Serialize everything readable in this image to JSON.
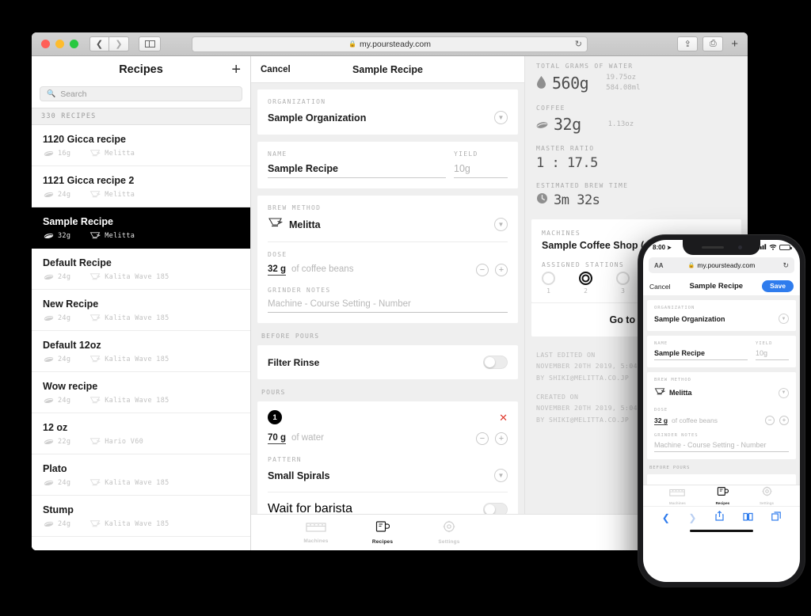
{
  "browser": {
    "url": "my.poursteady.com",
    "lock_icon": "lock-icon",
    "reload_icon": "reload-icon",
    "back_icon": "back-chevron-icon",
    "forward_icon": "forward-chevron-icon",
    "sidebar_icon": "sidebar-toggle-icon",
    "share_icon": "share-icon",
    "tabs_icon": "tabs-icon",
    "new_tab_icon": "plus-icon"
  },
  "sidebar": {
    "title": "Recipes",
    "add_icon": "plus-icon",
    "search": {
      "placeholder": "Search",
      "value": "",
      "icon": "search-icon"
    },
    "section_header": "330 RECIPES",
    "recipes": [
      {
        "name": "1120 Gicca recipe",
        "dose": "16g",
        "brew_method": "Melitta",
        "selected": false
      },
      {
        "name": "1121 Gicca recipe 2",
        "dose": "24g",
        "brew_method": "Melitta",
        "selected": false
      },
      {
        "name": "Sample Recipe",
        "dose": "32g",
        "brew_method": "Melitta",
        "selected": true
      },
      {
        "name": "Default Recipe",
        "dose": "24g",
        "brew_method": "Kalita Wave 185",
        "selected": false
      },
      {
        "name": "New Recipe",
        "dose": "24g",
        "brew_method": "Kalita Wave 185",
        "selected": false
      },
      {
        "name": "Default 12oz",
        "dose": "24g",
        "brew_method": "Kalita Wave 185",
        "selected": false
      },
      {
        "name": "Wow recipe",
        "dose": "24g",
        "brew_method": "Kalita Wave 185",
        "selected": false
      },
      {
        "name": "12 oz",
        "dose": "22g",
        "brew_method": "Hario V60",
        "selected": false
      },
      {
        "name": "Plato",
        "dose": "24g",
        "brew_method": "Kalita Wave 185",
        "selected": false
      },
      {
        "name": "Stump",
        "dose": "24g",
        "brew_method": "Kalita Wave 185",
        "selected": false
      }
    ]
  },
  "detail": {
    "cancel_label": "Cancel",
    "title": "Sample Recipe",
    "organization": {
      "label": "ORGANIZATION",
      "value": "Sample Organization"
    },
    "name": {
      "label": "NAME",
      "value": "Sample Recipe"
    },
    "yield": {
      "label": "YIELD",
      "value": "10g"
    },
    "brew_method": {
      "label": "BREW METHOD",
      "value": "Melitta"
    },
    "dose": {
      "label": "DOSE",
      "value": "32 g",
      "unit": "of coffee beans",
      "minus": "−",
      "plus": "+"
    },
    "grinder_notes": {
      "label": "GRINDER NOTES",
      "placeholder": "Machine - Course Setting - Number",
      "value": ""
    },
    "before_pours": {
      "group_label": "BEFORE POURS",
      "filter_rinse_label": "Filter Rinse",
      "filter_rinse_on": false
    },
    "pours": {
      "group_label": "POURS",
      "items": [
        {
          "number": "1",
          "amount": "70 g",
          "unit": "of water",
          "pattern_label": "PATTERN",
          "pattern_value": "Small Spirals",
          "wait_label": "Wait for barista",
          "wait_on": false,
          "delete_icon": "close-icon"
        }
      ]
    }
  },
  "stats": {
    "total_water": {
      "label": "TOTAL GRAMS OF WATER",
      "value": "560g",
      "alt1": "19.75oz",
      "alt2": "584.08ml",
      "icon": "water-drop-icon"
    },
    "coffee": {
      "label": "COFFEE",
      "value": "32g",
      "alt1": "1.13oz",
      "icon": "coffee-bean-icon"
    },
    "master_ratio": {
      "label": "MASTER RATIO",
      "value": "1 : 17.5"
    },
    "brew_time": {
      "label": "ESTIMATED BREW TIME",
      "value": "3m 32s",
      "icon": "clock-icon"
    },
    "machines": {
      "label": "MACHINES",
      "name": "Sample Coffee Shop (",
      "stations_label": "ASSIGNED STATIONS",
      "stations": [
        {
          "number": "1",
          "active": false
        },
        {
          "number": "2",
          "active": true
        },
        {
          "number": "3",
          "active": false
        }
      ],
      "goto_label": "Go to Mach"
    },
    "log": {
      "last_edited_label": "LAST EDITED ON",
      "last_edited_date": "NOVEMBER 20TH 2019, 5:04",
      "last_edited_by": "BY SHIKI@MELITTA.CO.JP",
      "created_label": "CREATED ON",
      "created_date": "NOVEMBER 20TH 2019, 5:04",
      "created_by": "BY SHIKI@MELITTA.CO.JP"
    }
  },
  "tabbar": {
    "machines": "Machines",
    "recipes": "Recipes",
    "settings": "Settings"
  },
  "phone": {
    "status": {
      "time": "8:00",
      "location_icon": "location-arrow-icon",
      "signal_icon": "cellular-icon",
      "wifi_icon": "wifi-icon",
      "battery_icon": "battery-icon"
    },
    "urlbar": {
      "aa_label": "AA",
      "url": "my.poursteady.com",
      "lock_icon": "lock-icon",
      "reload_icon": "reload-icon"
    },
    "navbar": {
      "cancel_label": "Cancel",
      "title": "Sample Recipe",
      "save_label": "Save"
    },
    "organization": {
      "label": "ORGANIZATION",
      "value": "Sample Organization"
    },
    "name": {
      "label": "NAME",
      "value": "Sample Recipe"
    },
    "yield": {
      "label": "YIELD",
      "value": "10g"
    },
    "brew_method": {
      "label": "BREW METHOD",
      "value": "Melitta"
    },
    "dose": {
      "label": "DOSE",
      "value": "32 g",
      "unit": "of coffee beans",
      "minus": "−",
      "plus": "+"
    },
    "grinder_notes": {
      "label": "GRINDER NOTES",
      "placeholder": "Machine - Course Setting - Number"
    },
    "before_pours_label": "BEFORE POURS",
    "tabbar": {
      "machines": "Machines",
      "recipes": "Recipes",
      "settings": "Settings"
    },
    "bottombar": {
      "back_icon": "back-chevron-icon",
      "forward_icon": "forward-chevron-icon",
      "share_icon": "share-icon",
      "bookmarks_icon": "book-icon",
      "tabs_icon": "tabs-icon"
    }
  },
  "colors": {
    "accent": "#2f7ced",
    "danger": "#e03b30",
    "selected_bg": "#000000",
    "panel_bg": "#efefef"
  }
}
